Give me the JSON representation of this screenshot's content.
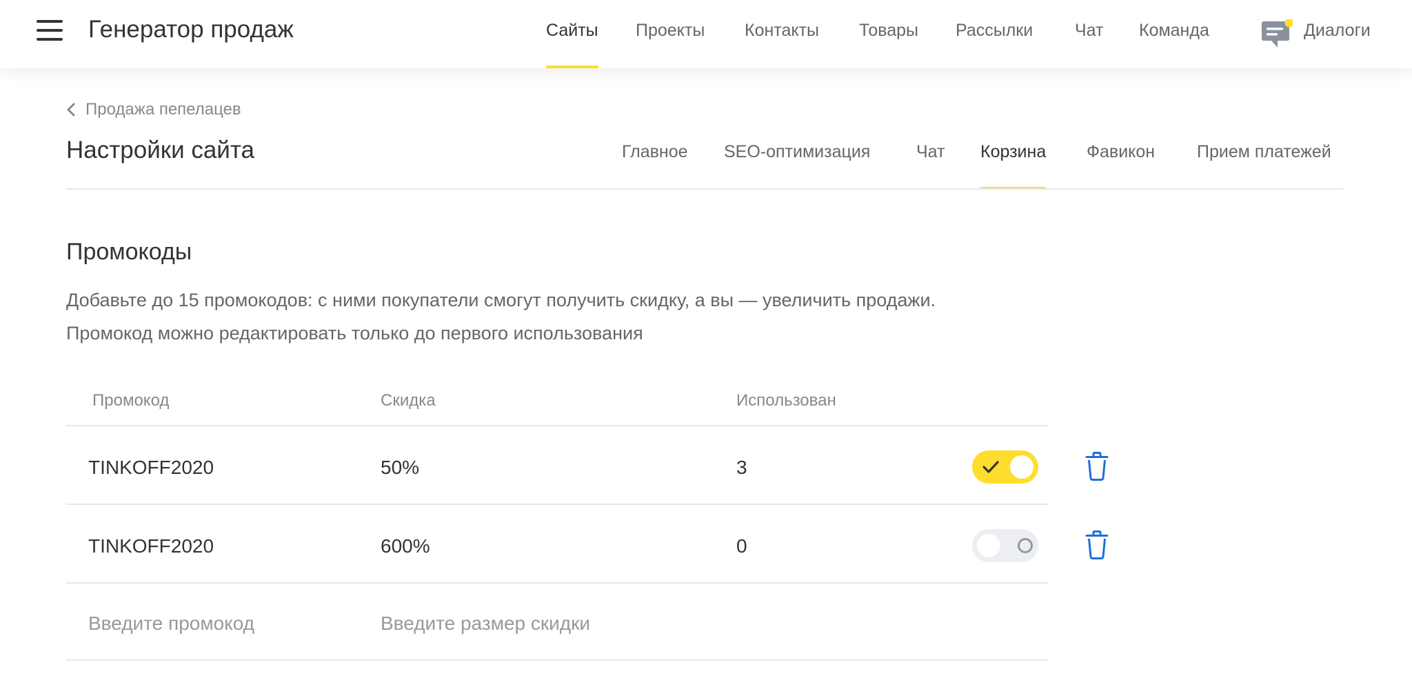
{
  "header": {
    "app_title": "Генератор продаж",
    "nav": [
      {
        "label": "Сайты",
        "active": true
      },
      {
        "label": "Проекты",
        "active": false
      },
      {
        "label": "Контакты",
        "active": false
      },
      {
        "label": "Товары",
        "active": false
      },
      {
        "label": "Рассылки",
        "active": false
      },
      {
        "label": "Чат",
        "active": false
      },
      {
        "label": "Команда",
        "active": false
      }
    ],
    "dialogs": {
      "label": "Диалоги",
      "has_unread": true,
      "icon": "chat-bubble-icon"
    }
  },
  "page": {
    "breadcrumb": "Продажа пепелацев",
    "title": "Настройки сайта",
    "tabs": [
      {
        "label": "Главное",
        "active": false
      },
      {
        "label": "SEO-оптимизация",
        "active": false
      },
      {
        "label": "Чат",
        "active": false
      },
      {
        "label": "Корзина",
        "active": true
      },
      {
        "label": "Фавикон",
        "active": false
      },
      {
        "label": "Прием платежей",
        "active": false
      }
    ]
  },
  "promo": {
    "title": "Промокоды",
    "description": [
      "Добавьте до 15 промокодов: с ними покупатели смогут получить скидку, а вы — увеличить продажи.",
      "Промокод можно редактировать только до первого использования"
    ],
    "columns": [
      "Промокод",
      "Скидка",
      "Использован"
    ],
    "rows": [
      {
        "code": "TINKOFF2020",
        "discount": "50%",
        "used": "3",
        "enabled": true
      },
      {
        "code": "TINKOFF2020",
        "discount": "600%",
        "used": "0",
        "enabled": false
      }
    ],
    "new_row": {
      "code_placeholder": "Введите промокод",
      "discount_placeholder": "Введите размер скидки",
      "code_value": "",
      "discount_value": ""
    }
  },
  "colors": {
    "accent": "#ffdd2d",
    "delete_icon": "#1e6fd9",
    "text_primary": "#333333",
    "text_secondary": "#666666"
  }
}
